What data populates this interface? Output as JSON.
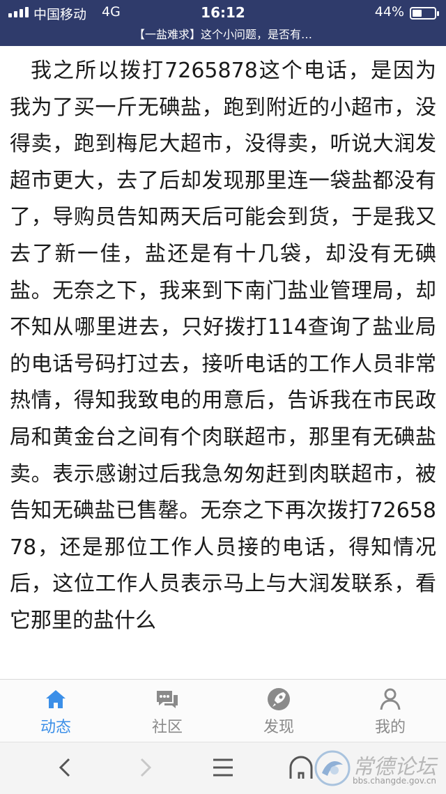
{
  "status_bar": {
    "carrier": "中国移动",
    "network": "4G",
    "time": "16:12",
    "battery_percent": "44%",
    "battery_level": 0.44
  },
  "header": {
    "title": "【一盐难求】这个小问题，是否有…"
  },
  "article": {
    "text": "我之所以拨打7265878这个电话，是因为我为了买一斤无碘盐，跑到附近的小超市，没得卖，跑到梅尼大超市，没得卖，听说大润发超市更大，去了后却发现那里连一袋盐都没有了，导购员告知两天后可能会到货，于是我又去了新一佳，盐还是有十几袋，却没有无碘盐。无奈之下，我来到下南门盐业管理局，却不知从哪里进去，只好拨打114查询了盐业局的电话号码打过去，接听电话的工作人员非常热情，得知我致电的用意后，告诉我在市民政局和黄金台之间有个肉联超市，那里有无碘盐卖。表示感谢过后我急匆匆赶到肉联超市，被告知无碘盐已售罄。无奈之下再次拨打7265878，还是那位工作人员接的电话，得知情况后，这位工作人员表示马上与大润发联系，看它那里的盐什么"
  },
  "tabbar": {
    "items": [
      {
        "label": "动态",
        "icon": "home-icon",
        "active": true
      },
      {
        "label": "社区",
        "icon": "chat-bubbles-icon",
        "active": false
      },
      {
        "label": "发现",
        "icon": "rocket-icon",
        "active": false
      },
      {
        "label": "我的",
        "icon": "person-icon",
        "active": false
      }
    ]
  },
  "browser": {
    "buttons": [
      "back-icon",
      "forward-icon",
      "menu-icon",
      "home-outline-icon"
    ]
  },
  "watermark": {
    "name": "常德论坛",
    "url": "bbs.changde.gov.cn"
  },
  "colors": {
    "header_bg": "#2f3b6b",
    "accent": "#3b8fe8",
    "tab_inactive": "#8a8a8a"
  }
}
